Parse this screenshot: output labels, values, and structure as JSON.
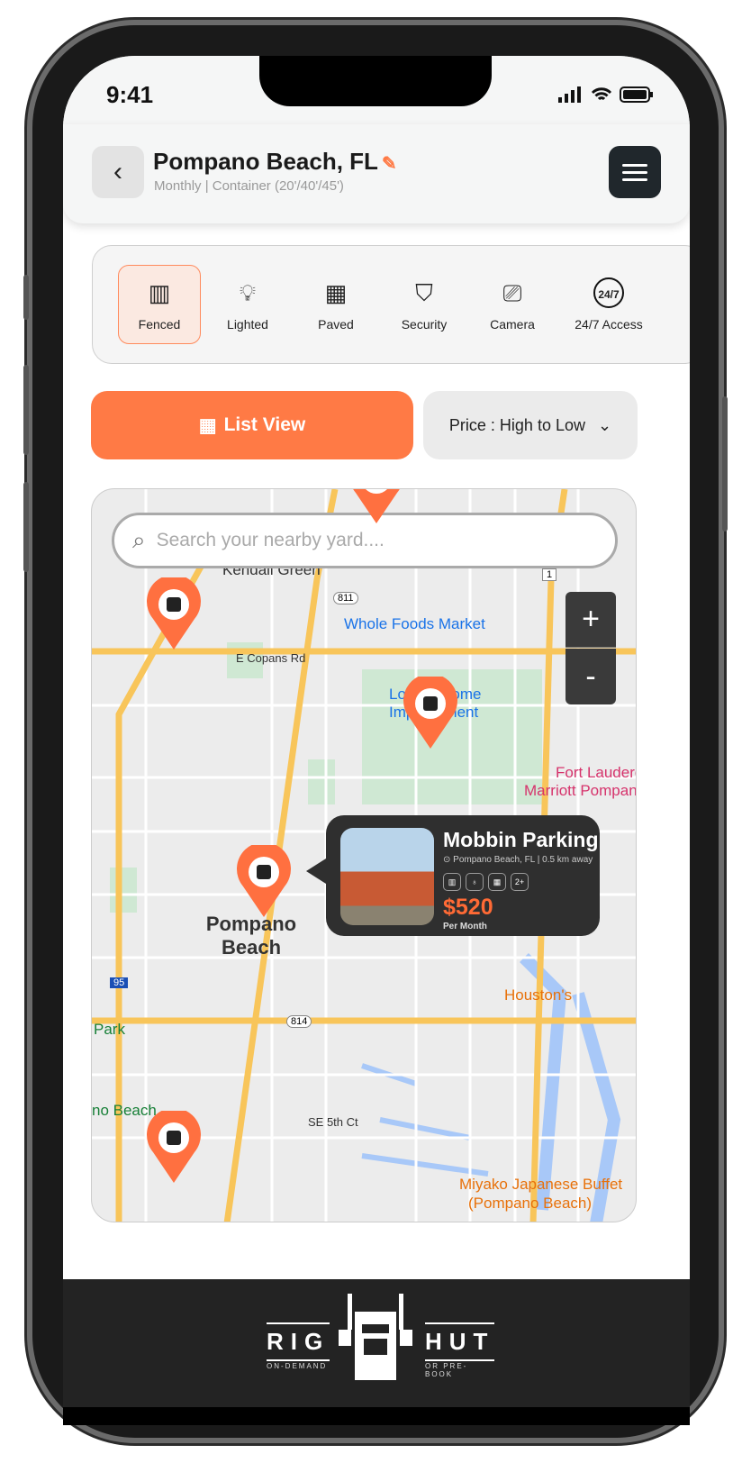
{
  "status": {
    "time": "9:41"
  },
  "header": {
    "title": "Pompano Beach, FL",
    "subtitle": "Monthly | Container (20'/40'/45')",
    "back_icon": "chevron-left-icon",
    "menu_icon": "hamburger-icon"
  },
  "amenities": [
    {
      "label": "Fenced",
      "icon": "fence-icon",
      "selected": true
    },
    {
      "label": "Lighted",
      "icon": "bulb-icon",
      "selected": false
    },
    {
      "label": "Paved",
      "icon": "paving-icon",
      "selected": false
    },
    {
      "label": "Security",
      "icon": "shield-check-icon",
      "selected": false
    },
    {
      "label": "Camera",
      "icon": "cctv-icon",
      "selected": false
    },
    {
      "label": "24/7 Access",
      "icon": "clock-24-7-icon",
      "selected": false
    }
  ],
  "actions": {
    "list_view": "List View",
    "sort": "Price : High to Low"
  },
  "map": {
    "search_placeholder": "Search your nearby yard....",
    "labels": {
      "kendall": "Kendall Green",
      "wholefoods": "Whole Foods Market",
      "copans": "E Copans Rd",
      "lowes": "Lowe's Home Improvement",
      "marriott1": "Fort Lauderdale",
      "marriott2": "Marriott Pompano",
      "pompano": "Pompano Beach",
      "houstons": "Houston's",
      "park": "Park",
      "nobeach": "no Beach",
      "se5": "SE 5th Ct",
      "miyako1": "Miyako Japanese Buffet",
      "miyako2": "(Pompano Beach)",
      "r811": "811",
      "r814": "814",
      "r1": "1",
      "r95": "95"
    },
    "zoom_in": "+",
    "zoom_out": "-"
  },
  "card": {
    "name": "Mobbin Parking",
    "location": "Pompano Beach, FL",
    "distance": "| 0.5 km away",
    "more": "2+",
    "price": "$520",
    "period": "Per Month"
  },
  "footer": {
    "logo_left": "RIG",
    "logo_right": "HUT",
    "tag_left": "ON-DEMAND",
    "tag_right": "OR PRE-BOOK"
  }
}
